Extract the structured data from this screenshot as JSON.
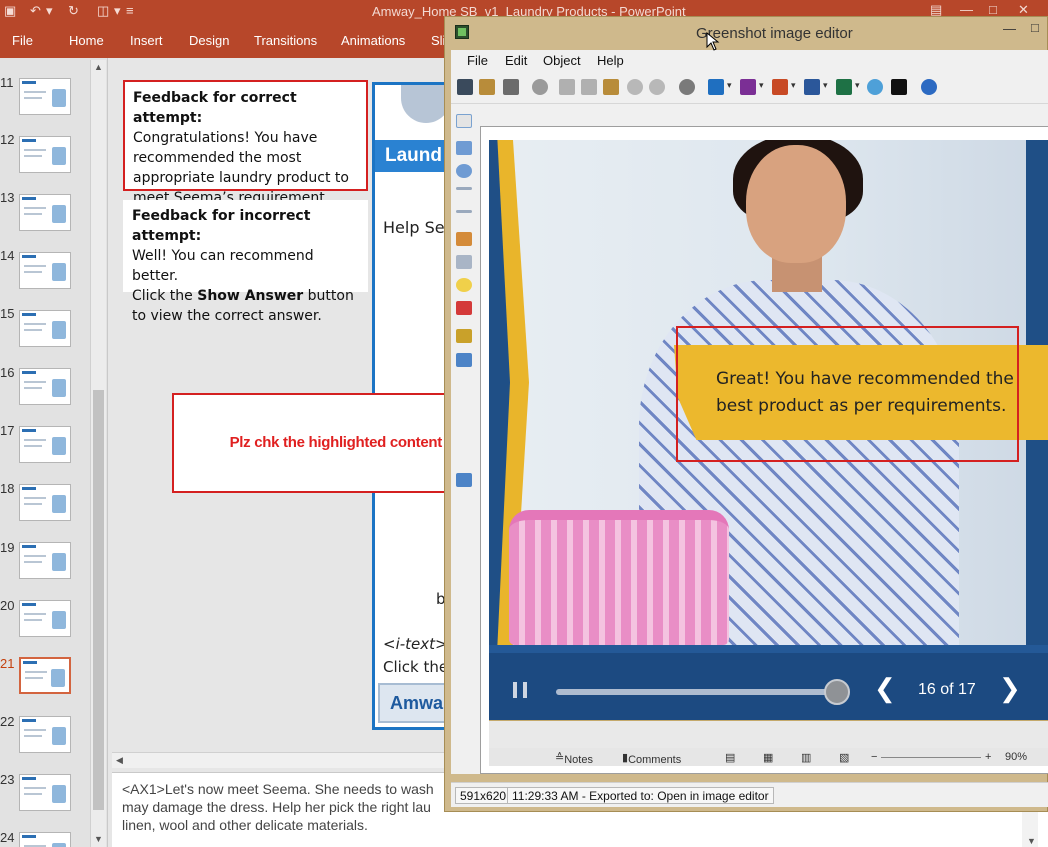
{
  "powerpoint": {
    "title": "Amway_Home SB_v1_Laundry Products - PowerPoint",
    "ribbon_tabs": [
      "File",
      "Home",
      "Insert",
      "Design",
      "Transitions",
      "Animations",
      "Sli"
    ],
    "slide_numbers": [
      "11",
      "12",
      "13",
      "14",
      "15",
      "16",
      "17",
      "18",
      "19",
      "20",
      "21",
      "22",
      "23",
      "24"
    ],
    "active_slide": "21",
    "feedback_correct": {
      "heading": "Feedback for correct attempt:",
      "body": "Congratulations! You have recommended the most appropriate laundry product to meet Seema’s requirement."
    },
    "feedback_incorrect": {
      "heading": "Feedback for incorrect attempt:",
      "line1": "Well! You can recommend better.",
      "click_prefix": "Click the",
      "show_answer": "Show Answer",
      "click_suffix": "button to view the correct answer."
    },
    "slide_panel": {
      "laund": "Laund",
      "help": "Help See",
      "b": "b",
      "itext": "<i-text>",
      "clickthe": "Click the",
      "amway": "Amwa"
    },
    "review_comment": "Plz chk the highlighted content mismatch",
    "notes": {
      "tag": "<AX1>",
      "line1": "Let's now meet Seema. She needs to wash",
      "line2": "may damage the dress. Help her pick the right lau",
      "line3": "linen, wool and other delicate materials."
    }
  },
  "greenshot": {
    "title": "Greenshot image editor",
    "menu": [
      "File",
      "Edit",
      "Object",
      "Help"
    ],
    "status": {
      "size": "591x620",
      "message": "11:29:33 AM - Exported to: Open in image editor"
    },
    "captured": {
      "banner_text": "Great! You have recommended the best product as per requirements.",
      "counter": "16 of 17",
      "progress": 0.98,
      "strip_notes": "Notes",
      "strip_comments": "Comments",
      "zoom": "90%"
    }
  },
  "colors": {
    "ppt_red": "#b7472a",
    "greenshot_frame": "#cfb98c",
    "highlight_red": "#d42020",
    "banner_yellow": "#ecb82d",
    "player_blue": "#1c4a81"
  }
}
